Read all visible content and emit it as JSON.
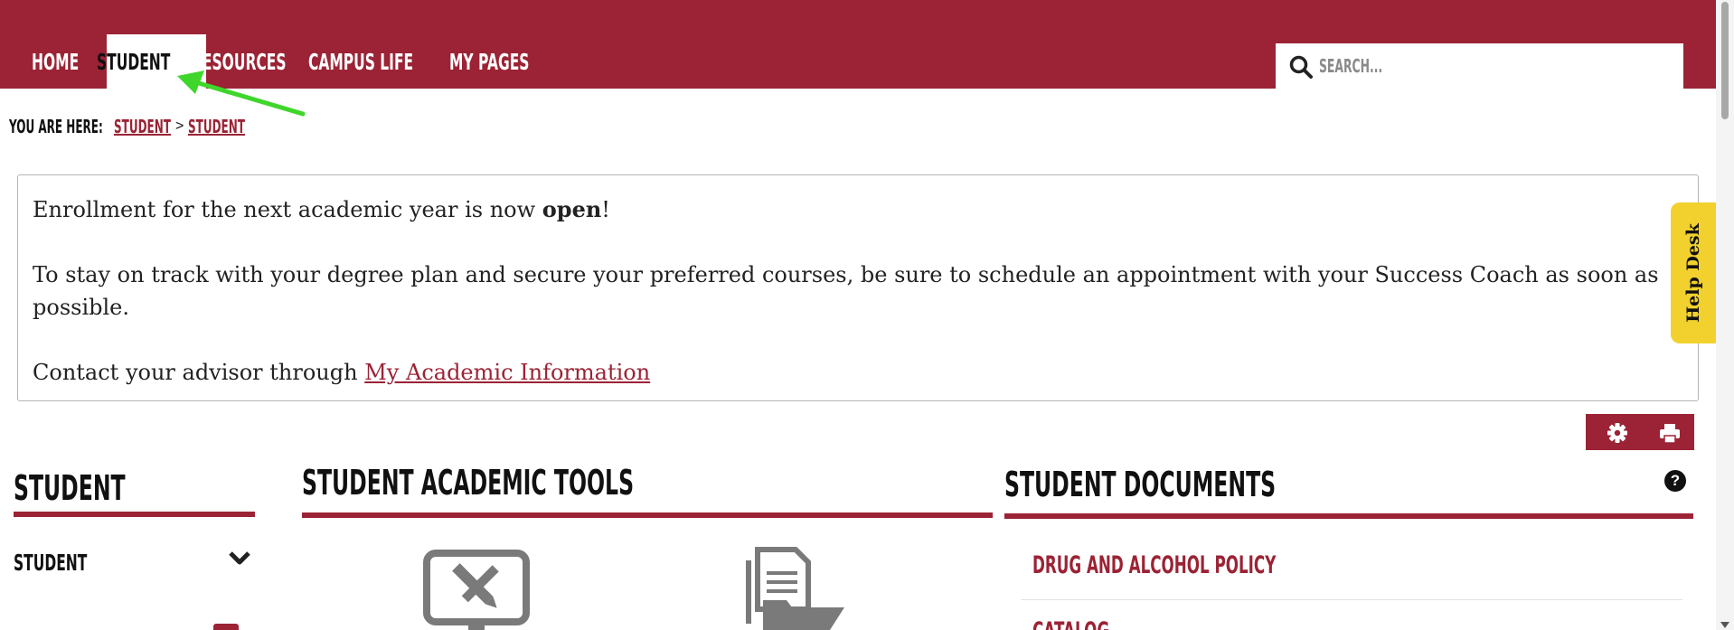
{
  "nav": {
    "items": [
      {
        "label": "HOME"
      },
      {
        "label": "STUDENT",
        "active": true
      },
      {
        "label": "RESOURCES"
      },
      {
        "label": "CAMPUS LIFE"
      },
      {
        "label": "MY PAGES"
      }
    ],
    "search_placeholder": "SEARCH..."
  },
  "breadcrumb": {
    "label": "YOU ARE HERE:",
    "links": [
      "STUDENT",
      "STUDENT"
    ],
    "separator": ">"
  },
  "notice": {
    "line1_prefix": "Enrollment for the next academic year is now ",
    "line1_bold": "open",
    "line1_suffix": "!",
    "line2": "To stay on track with your degree plan and secure your preferred courses, be sure to schedule an appointment with your Success Coach as soon as possible.",
    "line3_prefix": "Contact your advisor through ",
    "line3_link": "My Academic Information"
  },
  "help_desk": {
    "label": "Help Desk"
  },
  "left_column": {
    "title": "STUDENT",
    "menu_item": "STUDENT"
  },
  "middle_column": {
    "title": "STUDENT ACADEMIC TOOLS"
  },
  "right_column": {
    "title": "STUDENT DOCUMENTS",
    "help": "?",
    "links": [
      "DRUG AND ALCOHOL POLICY",
      "CATALOG"
    ]
  },
  "colors": {
    "brand": "#9b2335",
    "help_desk": "#f2d12e"
  },
  "icons": [
    "search-icon",
    "gear-icon",
    "print-icon",
    "chevron-down-icon",
    "question-icon",
    "computer-pencil-icon",
    "documents-folder-icon"
  ]
}
